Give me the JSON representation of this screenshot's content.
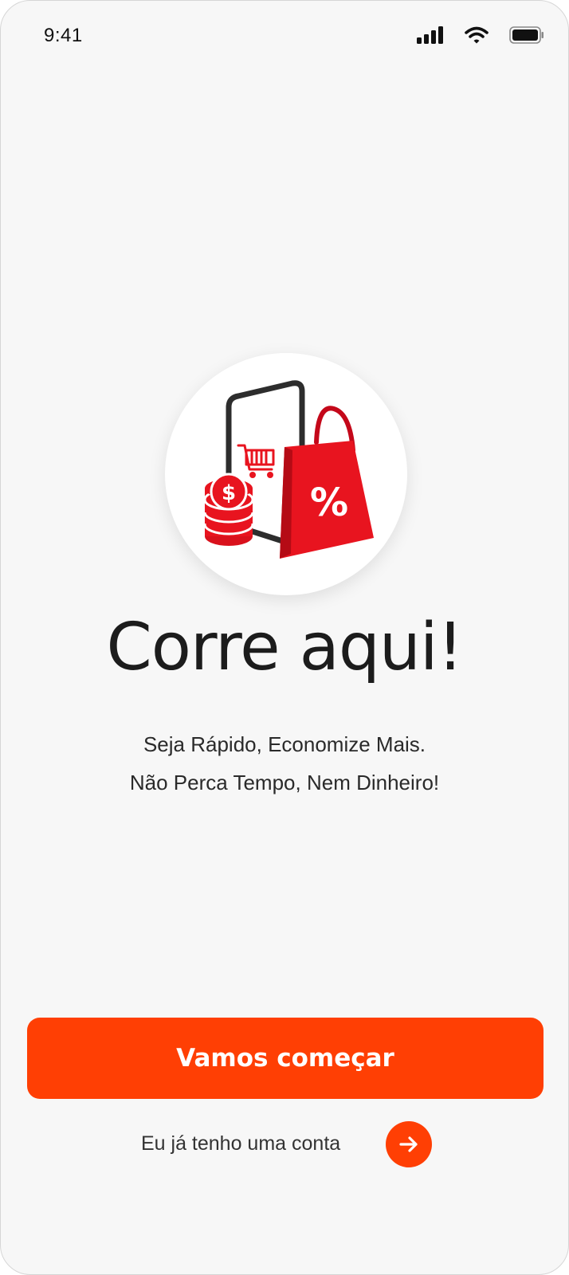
{
  "status_bar": {
    "time": "9:41"
  },
  "hero": {
    "icon": "shopping-promo-illustration",
    "badge_symbol": "%",
    "coin_symbol": "$"
  },
  "title": "Corre aqui!",
  "subtitle": {
    "line1": "Seja Rápido, Economize Mais.",
    "line2": "Não Perca Tempo, Nem Dinheiro!"
  },
  "actions": {
    "primary_label": "Vamos começar",
    "login_text": "Eu já tenho uma conta",
    "login_icon": "arrow-right-icon"
  },
  "colors": {
    "accent": "#ff3f04",
    "illustration_red": "#e8141f",
    "background": "#f7f7f7",
    "text": "#1c1c1c"
  }
}
